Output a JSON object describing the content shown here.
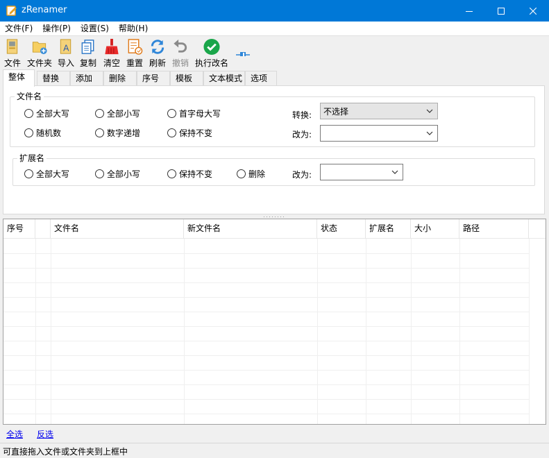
{
  "window": {
    "title": "zRenamer"
  },
  "menu": [
    "文件(F)",
    "操作(P)",
    "设置(S)",
    "帮助(H)"
  ],
  "toolbar": {
    "file": "文件",
    "folder": "文件夹",
    "import": "导入",
    "copy": "复制",
    "clear": "清空",
    "reset": "重置",
    "refresh": "刷新",
    "undo": "撤销",
    "execute": "执行改名"
  },
  "tabs": [
    "整体",
    "替换",
    "添加",
    "删除",
    "序号",
    "模板",
    "文本模式",
    "选项"
  ],
  "filename_group": {
    "title": "文件名",
    "options": [
      "全部大写",
      "全部小写",
      "首字母大写",
      "随机数",
      "数字递增",
      "保持不变"
    ],
    "convert_label": "转换:",
    "convert_value": "不选择",
    "change_label": "改为:",
    "change_value": ""
  },
  "extension_group": {
    "title": "扩展名",
    "options": [
      "全部大写",
      "全部小写",
      "保持不变",
      "删除"
    ],
    "change_label": "改为:",
    "change_value": ""
  },
  "grid": {
    "columns": [
      "序号",
      "",
      "文件名",
      "新文件名",
      "状态",
      "扩展名",
      "大小",
      "路径"
    ]
  },
  "links": {
    "select_all": "全选",
    "invert": "反选"
  },
  "status": "可直接拖入文件或文件夹到上框中",
  "colors": {
    "titlebar": "#0078d7",
    "link": "#0000ee",
    "execute_green": "#1aa64a"
  }
}
